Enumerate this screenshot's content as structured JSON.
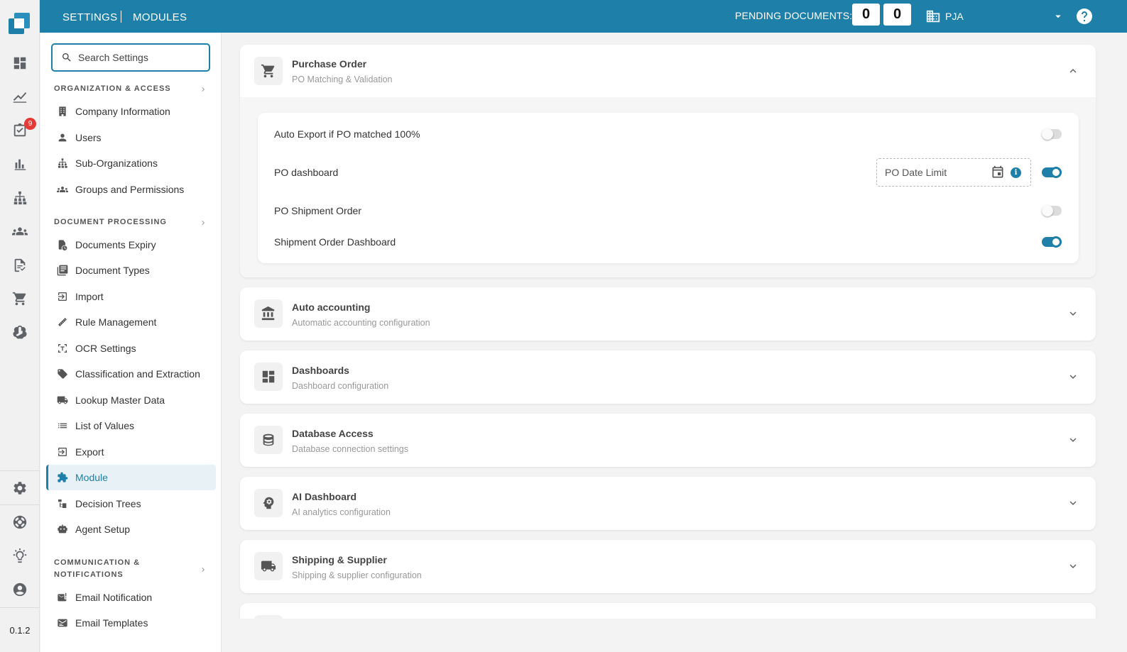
{
  "topbar": {
    "crumb_settings": "SETTINGS",
    "crumb_modules": "MODULES",
    "pending_label": "PENDING DOCUMENTS:",
    "pending_counts": [
      "0",
      "0"
    ],
    "org_name": "PJA",
    "accent": "#1e7fa9"
  },
  "rail": {
    "badge": "9",
    "version": "0.1.2",
    "icons": [
      "dashboard-icon",
      "trend-icon",
      "task-icon",
      "bar-chart-icon",
      "hierarchy-icon",
      "groups-icon",
      "document-check-icon",
      "cart-icon",
      "ai-icon",
      "settings-icon",
      "support-icon",
      "lightbulb-icon",
      "account-icon"
    ]
  },
  "sidebar": {
    "search_placeholder": "Search Settings",
    "sections": [
      {
        "title": "ORGANIZATION & ACCESS",
        "items": [
          "Company Information",
          "Users",
          "Sub-Organizations",
          "Groups and Permissions"
        ]
      },
      {
        "title": "DOCUMENT PROCESSING",
        "items": [
          "Documents Expiry",
          "Document Types",
          "Import",
          "Rule Management",
          "OCR Settings",
          "Classification and Extraction",
          "Lookup Master Data",
          "List of Values",
          "Export",
          "Module",
          "Decision Trees",
          "Agent Setup"
        ]
      },
      {
        "title": "COMMUNICATION & NOTIFICATIONS",
        "items": [
          "Email Notification",
          "Email Templates"
        ]
      }
    ],
    "active_item": "Module"
  },
  "modules": {
    "purchase_order": {
      "title": "Purchase Order",
      "subtitle": "PO Matching & Validation",
      "expanded": true,
      "settings": [
        {
          "label": "Auto Export if PO matched 100%",
          "enabled": false
        },
        {
          "label": "PO dashboard",
          "enabled": true,
          "field_placeholder": "PO Date Limit"
        },
        {
          "label": "PO Shipment Order",
          "enabled": false
        },
        {
          "label": "Shipment Order Dashboard",
          "enabled": true
        }
      ]
    },
    "collapsed": [
      {
        "title": "Auto accounting",
        "subtitle": "Automatic accounting configuration",
        "icon": "bank-icon"
      },
      {
        "title": "Dashboards",
        "subtitle": "Dashboard configuration",
        "icon": "dashboard-icon"
      },
      {
        "title": "Database Access",
        "subtitle": "Database connection settings",
        "icon": "database-icon"
      },
      {
        "title": "AI Dashboard",
        "subtitle": "AI analytics configuration",
        "icon": "ai-head-icon"
      },
      {
        "title": "Shipping & Supplier",
        "subtitle": "Shipping & supplier configuration",
        "icon": "truck-icon"
      }
    ]
  }
}
